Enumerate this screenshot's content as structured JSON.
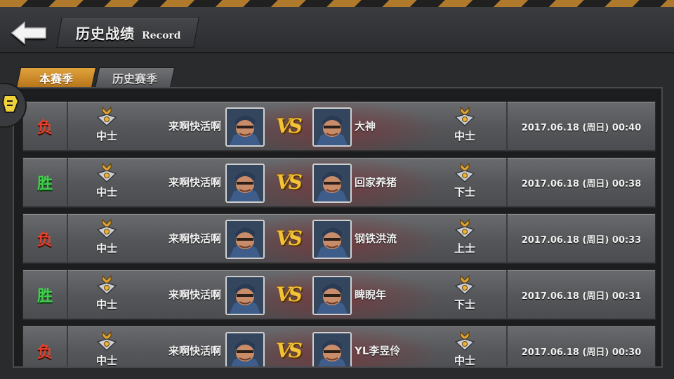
{
  "header": {
    "title_cn": "历史战绩",
    "title_en": "Record"
  },
  "tabs": [
    {
      "label": "本赛季",
      "active": true
    },
    {
      "label": "历史赛季",
      "active": false
    }
  ],
  "colors": {
    "win": "#3ed04a",
    "lose": "#e3412b",
    "tab_active": "#d08f2c",
    "vs": "#f2c23a"
  },
  "records": [
    {
      "result": "负",
      "outcome": "lose",
      "player_rank": "中士",
      "player_name": "来啊快活啊",
      "opponent_name": "大神",
      "opponent_rank": "中士",
      "time": "2017.06.18 (周日) 00:40"
    },
    {
      "result": "胜",
      "outcome": "win",
      "player_rank": "中士",
      "player_name": "来啊快活啊",
      "opponent_name": "回家养猪",
      "opponent_rank": "下士",
      "time": "2017.06.18 (周日) 00:38"
    },
    {
      "result": "负",
      "outcome": "lose",
      "player_rank": "中士",
      "player_name": "来啊快活啊",
      "opponent_name": "钢铁洪流",
      "opponent_rank": "上士",
      "time": "2017.06.18 (周日) 00:33"
    },
    {
      "result": "胜",
      "outcome": "win",
      "player_rank": "中士",
      "player_name": "来啊快活啊",
      "opponent_name": "睥睨年",
      "opponent_rank": "下士",
      "time": "2017.06.18 (周日) 00:31"
    },
    {
      "result": "负",
      "outcome": "lose",
      "player_rank": "中士",
      "player_name": "来啊快活啊",
      "opponent_name": "YL李昱伶",
      "opponent_rank": "中士",
      "time": "2017.06.18 (周日) 00:30"
    }
  ],
  "vs_label": "VS"
}
